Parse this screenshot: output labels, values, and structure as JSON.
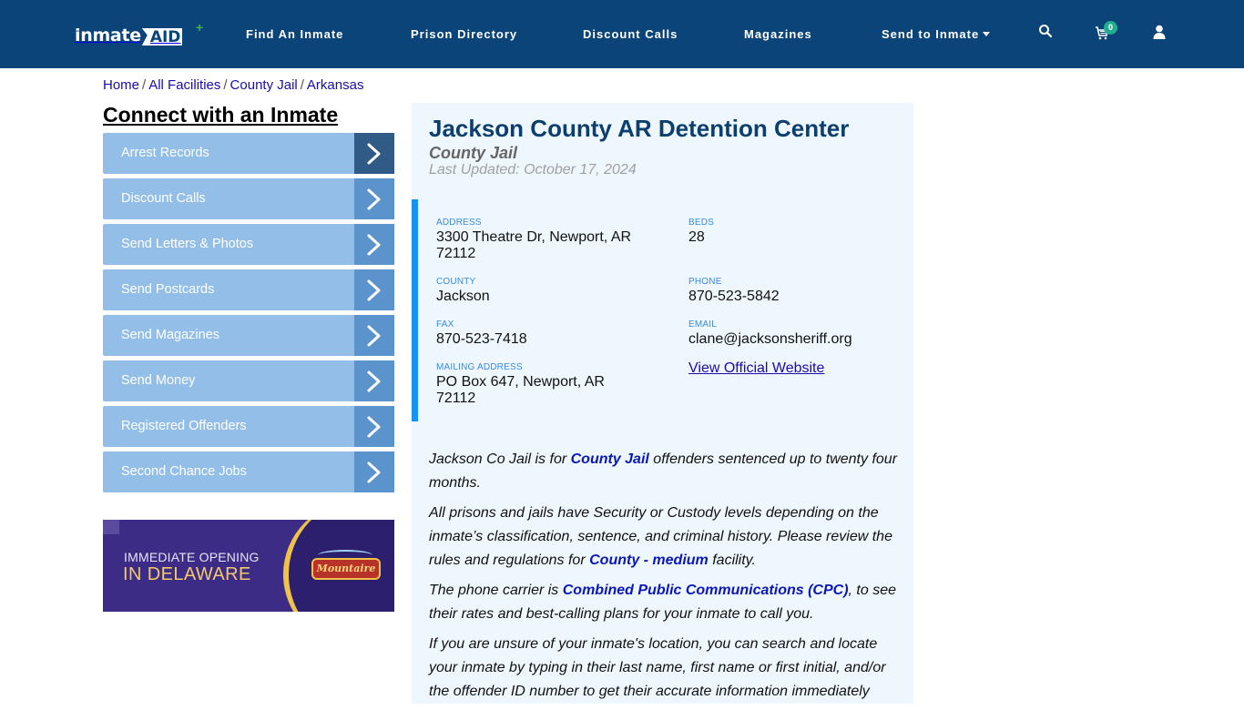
{
  "brand": {
    "name_part1": "inmate",
    "name_part2": "AID",
    "plus": "+"
  },
  "nav": {
    "links": [
      "Find An Inmate",
      "Prison Directory",
      "Discount Calls",
      "Magazines",
      "Send to Inmate"
    ],
    "cart_count": "0",
    "icons": [
      "search-icon",
      "cart-icon",
      "user-icon"
    ]
  },
  "breadcrumb": [
    "Home",
    "All Facilities",
    "County Jail",
    "Arkansas"
  ],
  "breadcrumb_sep": "/",
  "sidebar": {
    "title": "Connect with an Inmate",
    "items": [
      "Arrest Records",
      "Discount Calls",
      "Send Letters & Photos",
      "Send Postcards",
      "Send Magazines",
      "Send Money",
      "Registered Offenders",
      "Second Chance Jobs"
    ]
  },
  "ad": {
    "line1": "IMMEDIATE OPENING",
    "line2": "IN DELAWARE",
    "brand": "Mountaire"
  },
  "facility": {
    "name": "Jackson County AR Detention Center",
    "type": "County Jail",
    "updated": "Last Updated: October 17, 2024",
    "address_label": "ADDRESS",
    "address": "3300 Theatre Dr, Newport, AR 72112",
    "beds_label": "BEDS",
    "beds": "28",
    "county_label": "COUNTY",
    "county": "Jackson",
    "phone_label": "PHONE",
    "phone": "870-523-5842",
    "fax_label": "FAX",
    "fax": "870-523-7418",
    "email_label": "EMAIL",
    "email": "clane@jacksonsheriff.org",
    "mailing_label": "MAILING ADDRESS",
    "mailing": "PO Box 647, Newport, AR 72112",
    "website_link": "View Official Website"
  },
  "description": {
    "p1_a": "Jackson Co Jail is for ",
    "p1_link": "County Jail",
    "p1_b": " offenders sentenced up to twenty four months.",
    "p2_a": "All prisons and jails have Security or Custody levels depending on the inmate’s classification, sentence, and criminal history. Please review the rules and regulations for ",
    "p2_link": "County - medium",
    "p2_b": " facility.",
    "p3_a": "The phone carrier is ",
    "p3_link": "Combined Public Communications (CPC)",
    "p3_b": ", to see their rates and best-calling plans for your inmate to call you.",
    "p4": "If you are unsure of your inmate's location, you can search and locate your inmate by typing in their last name, first name or first initial, and/or the offender ID number to get their accurate information immediately"
  },
  "colors": {
    "nav_bg": "#0b4479",
    "side_item": "#93bee8",
    "side_arrow": "#5b93cd",
    "accent_bar": "#1592f2",
    "title": "#0c3f6e"
  }
}
